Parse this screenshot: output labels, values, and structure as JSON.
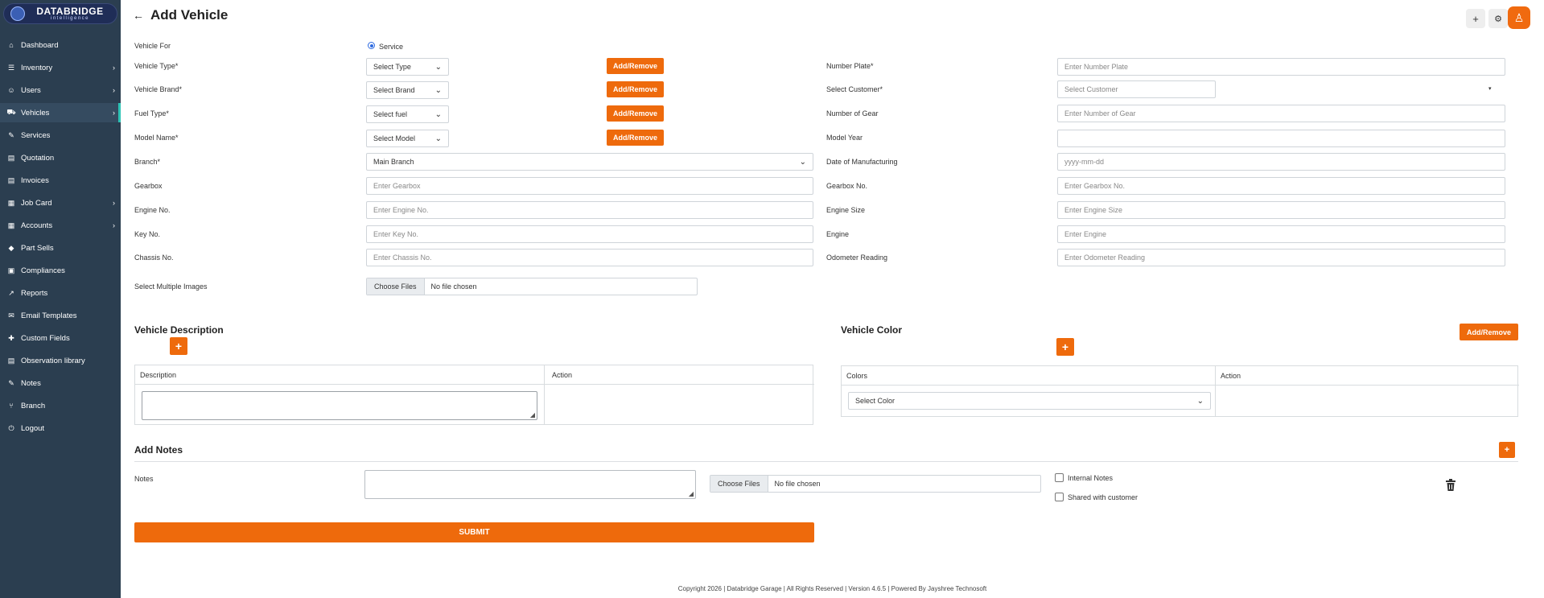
{
  "brand": {
    "name": "DATABRIDGE",
    "tagline": "intelligence"
  },
  "sidebar": {
    "items": [
      {
        "label": "Dashboard",
        "icon": "home-icon",
        "glyph": "⌂",
        "chevron": false,
        "active": false
      },
      {
        "label": "Inventory",
        "icon": "inventory-icon",
        "glyph": "☰",
        "chevron": true,
        "active": false
      },
      {
        "label": "Users",
        "icon": "user-icon",
        "glyph": "☺",
        "chevron": true,
        "active": false
      },
      {
        "label": "Vehicles",
        "icon": "car-icon",
        "glyph": "⛟",
        "chevron": true,
        "active": true
      },
      {
        "label": "Services",
        "icon": "wrench-icon",
        "glyph": "✎",
        "chevron": false,
        "active": false
      },
      {
        "label": "Quotation",
        "icon": "document-icon",
        "glyph": "▤",
        "chevron": false,
        "active": false
      },
      {
        "label": "Invoices",
        "icon": "invoice-icon",
        "glyph": "▤",
        "chevron": false,
        "active": false
      },
      {
        "label": "Job Card",
        "icon": "job-card-icon",
        "glyph": "▦",
        "chevron": true,
        "active": false
      },
      {
        "label": "Accounts",
        "icon": "accounts-icon",
        "glyph": "▦",
        "chevron": true,
        "active": false
      },
      {
        "label": "Part Sells",
        "icon": "tag-icon",
        "glyph": "◆",
        "chevron": false,
        "active": false
      },
      {
        "label": "Compliances",
        "icon": "clipboard-icon",
        "glyph": "▣",
        "chevron": false,
        "active": false
      },
      {
        "label": "Reports",
        "icon": "chart-icon",
        "glyph": "↗",
        "chevron": false,
        "active": false
      },
      {
        "label": "Email Templates",
        "icon": "email-icon",
        "glyph": "✉",
        "chevron": false,
        "active": false
      },
      {
        "label": "Custom Fields",
        "icon": "puzzle-icon",
        "glyph": "✚",
        "chevron": false,
        "active": false
      },
      {
        "label": "Observation library",
        "icon": "file-icon",
        "glyph": "▤",
        "chevron": false,
        "active": false
      },
      {
        "label": "Notes",
        "icon": "note-icon",
        "glyph": "✎",
        "chevron": false,
        "active": false
      },
      {
        "label": "Branch",
        "icon": "branch-icon",
        "glyph": "⑂",
        "chevron": false,
        "active": false
      },
      {
        "label": "Logout",
        "icon": "power-icon",
        "glyph": "⏻",
        "chevron": false,
        "active": false
      }
    ]
  },
  "header": {
    "title": "Add Vehicle",
    "back": "←",
    "plus": "+",
    "gear": "⚙",
    "avatar": "♙"
  },
  "form": {
    "vehicle_for": {
      "label": "Vehicle For",
      "option": "Service"
    },
    "vehicle_type": {
      "label": "Vehicle Type*",
      "value": "Select Type"
    },
    "vehicle_brand": {
      "label": "Vehicle Brand*",
      "value": "Select Brand"
    },
    "fuel_type": {
      "label": "Fuel Type*",
      "value": "Select fuel"
    },
    "model_name": {
      "label": "Model Name*",
      "value": "Select Model"
    },
    "add_remove": "Add/Remove",
    "branch": {
      "label": "Branch*",
      "value": "Main Branch"
    },
    "gearbox": {
      "label": "Gearbox",
      "placeholder": "Enter Gearbox"
    },
    "engine_no": {
      "label": "Engine No.",
      "placeholder": "Enter Engine No."
    },
    "key_no": {
      "label": "Key No.",
      "placeholder": "Enter Key No."
    },
    "chassis_no": {
      "label": "Chassis No.",
      "placeholder": "Enter Chassis No."
    },
    "images": {
      "label": "Select Multiple Images",
      "button": "Choose Files",
      "status": "No file chosen"
    },
    "number_plate": {
      "label": "Number Plate*",
      "placeholder": "Enter Number Plate"
    },
    "customer": {
      "label": "Select Customer*",
      "placeholder": "Select Customer"
    },
    "number_of_gear": {
      "label": "Number of Gear",
      "placeholder": "Enter Number of Gear"
    },
    "model_year": {
      "label": "Model Year",
      "value": ""
    },
    "date_of_manufacturing": {
      "label": "Date of Manufacturing",
      "placeholder": "yyyy-mm-dd"
    },
    "gearbox_no": {
      "label": "Gearbox No.",
      "placeholder": "Enter Gearbox No."
    },
    "engine_size": {
      "label": "Engine Size",
      "placeholder": "Enter Engine Size"
    },
    "engine": {
      "label": "Engine",
      "placeholder": "Enter Engine"
    },
    "odometer": {
      "label": "Odometer Reading",
      "placeholder": "Enter Odometer Reading"
    }
  },
  "description": {
    "title": "Vehicle Description",
    "plus": "+",
    "col_description": "Description",
    "col_action": "Action"
  },
  "color": {
    "title": "Vehicle Color",
    "add_remove": "Add/Remove",
    "plus": "+",
    "col_colors": "Colors",
    "col_action": "Action",
    "select": "Select Color"
  },
  "notes": {
    "title": "Add Notes",
    "plus": "+",
    "label": "Notes",
    "file_button": "Choose Files",
    "file_status": "No file chosen",
    "internal": "Internal Notes",
    "shared": "Shared with customer"
  },
  "submit": "SUBMIT",
  "footer": "Copyright 2026 | Databridge Garage | All Rights Reserved | Version 4.6.5 | Powered By Jayshree Technosoft"
}
